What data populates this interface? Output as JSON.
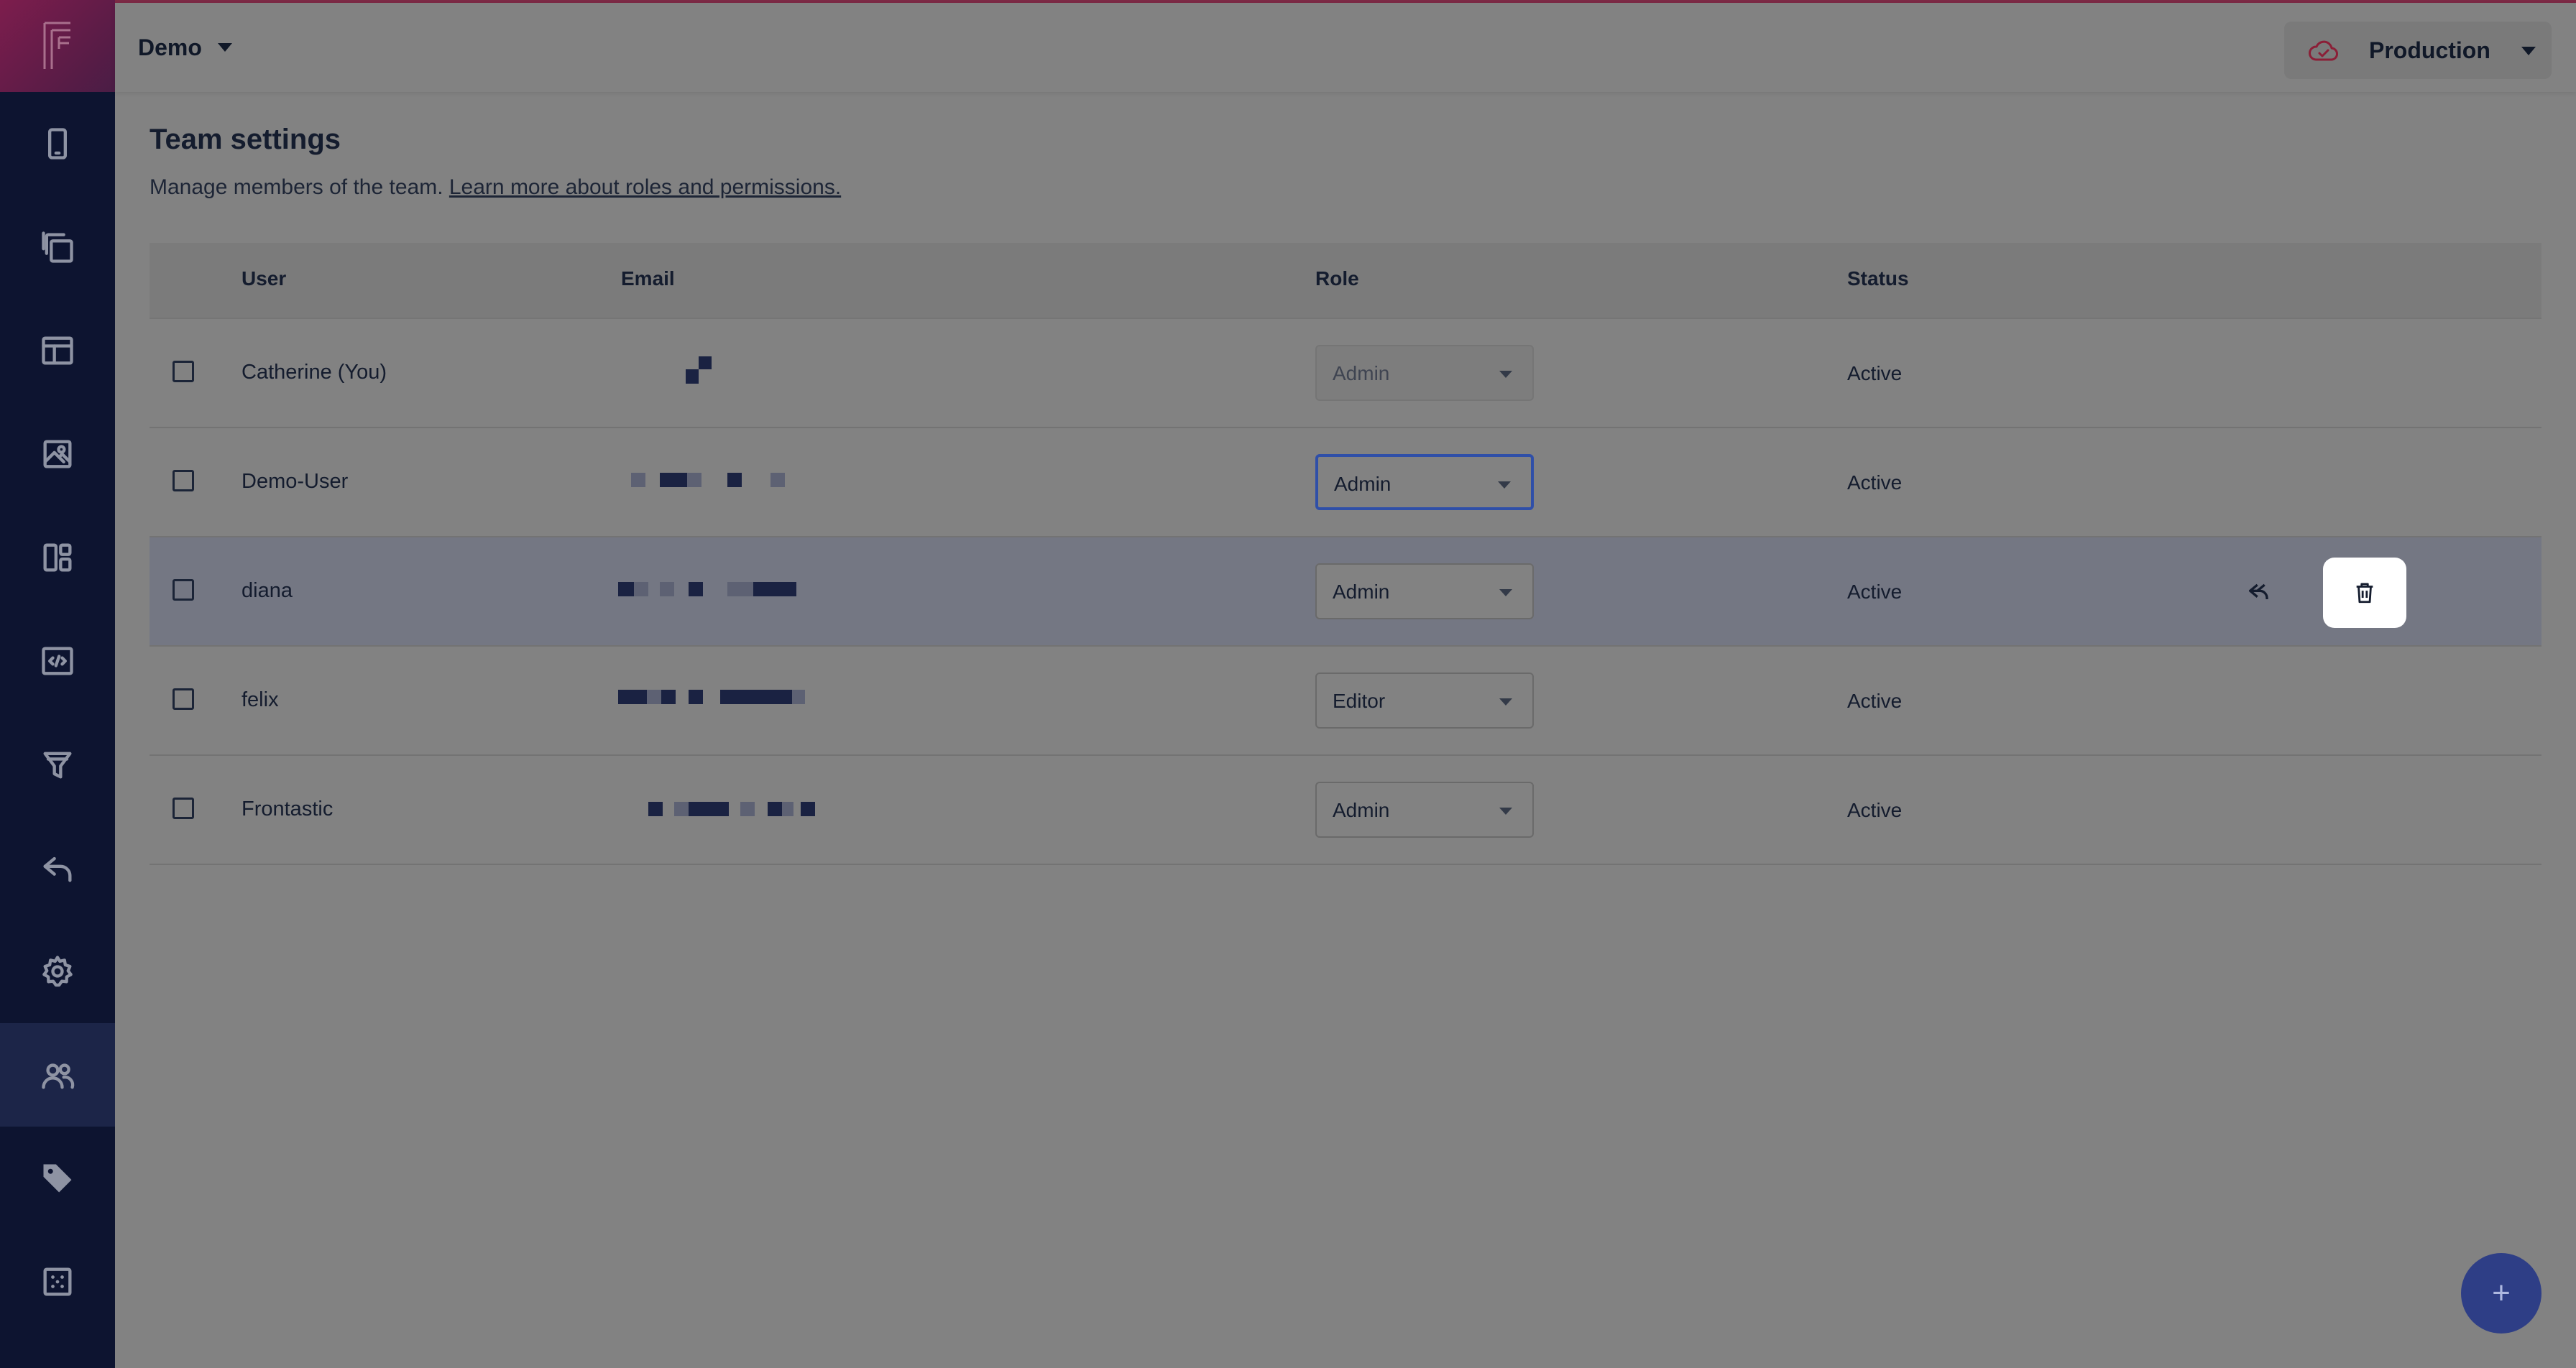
{
  "app": {
    "project": "Demo",
    "environment": "Production"
  },
  "sidebar": {
    "items": [
      {
        "icon": "tablet-icon"
      },
      {
        "icon": "copy-icon"
      },
      {
        "icon": "layout-icon"
      },
      {
        "icon": "image-icon"
      },
      {
        "icon": "dashboard-icon"
      },
      {
        "icon": "code-icon"
      },
      {
        "icon": "filter-icon"
      },
      {
        "icon": "reply-icon"
      },
      {
        "icon": "gear-icon"
      },
      {
        "icon": "team-icon",
        "active": true
      },
      {
        "icon": "tag-icon"
      },
      {
        "icon": "grid-icon"
      }
    ]
  },
  "page": {
    "title": "Team settings",
    "description": "Manage members of the team.",
    "link": "Learn more about roles and permissions."
  },
  "table": {
    "headers": {
      "user": "User",
      "email": "Email",
      "role": "Role",
      "status": "Status"
    },
    "rows": [
      {
        "user": "Catherine (You)",
        "role": "Admin",
        "status": "Active"
      },
      {
        "user": "Demo-User",
        "role": "Admin",
        "status": "Active"
      },
      {
        "user": "diana",
        "role": "Admin",
        "status": "Active"
      },
      {
        "user": "felix",
        "role": "Editor",
        "status": "Active"
      },
      {
        "user": "Frontastic",
        "role": "Admin",
        "status": "Active"
      }
    ]
  },
  "fab": {
    "label": "+"
  },
  "colors": {
    "sidebar": "#0d1430",
    "brand": "#7d1d4d",
    "accent": "#2e3e86"
  }
}
